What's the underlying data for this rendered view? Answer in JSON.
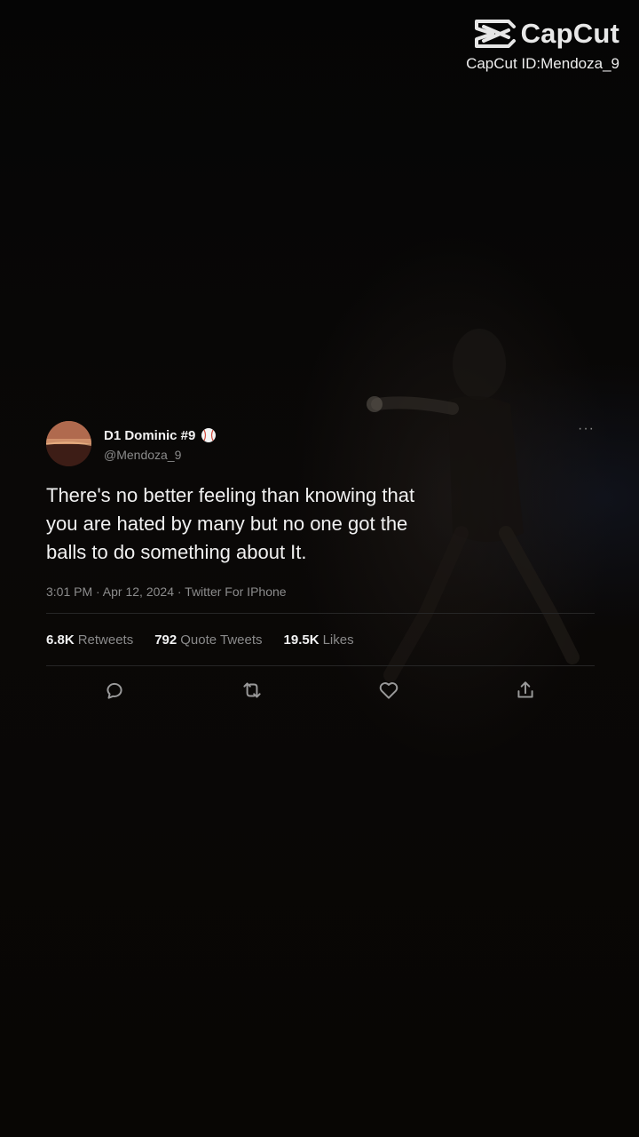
{
  "watermark": {
    "brand": "CapCut",
    "id_text": "CapCut ID:Mendoza_9"
  },
  "tweet": {
    "display_name": "D1 Dominic #9",
    "handle": "@Mendoza_9",
    "text": "There's no better feeling than knowing that\n you are hated by many but no one got the\nballs to do something about It.",
    "meta": "3:01 PM · Apr 12, 2024 · Twitter For IPhone",
    "more_label": "···",
    "stats": [
      {
        "value": "6.8K",
        "label": "Retweets"
      },
      {
        "value": "792",
        "label": "Quote Tweets"
      },
      {
        "value": "19.5K",
        "label": "Likes"
      }
    ],
    "actions": [
      "reply-icon",
      "retweet-icon",
      "like-icon",
      "share-icon"
    ],
    "badge_icon": "baseball-icon"
  },
  "colors": {
    "background": "#050505",
    "text_primary": "#f1f1f1",
    "text_secondary": "#8b8b8b",
    "divider": "#262626"
  }
}
